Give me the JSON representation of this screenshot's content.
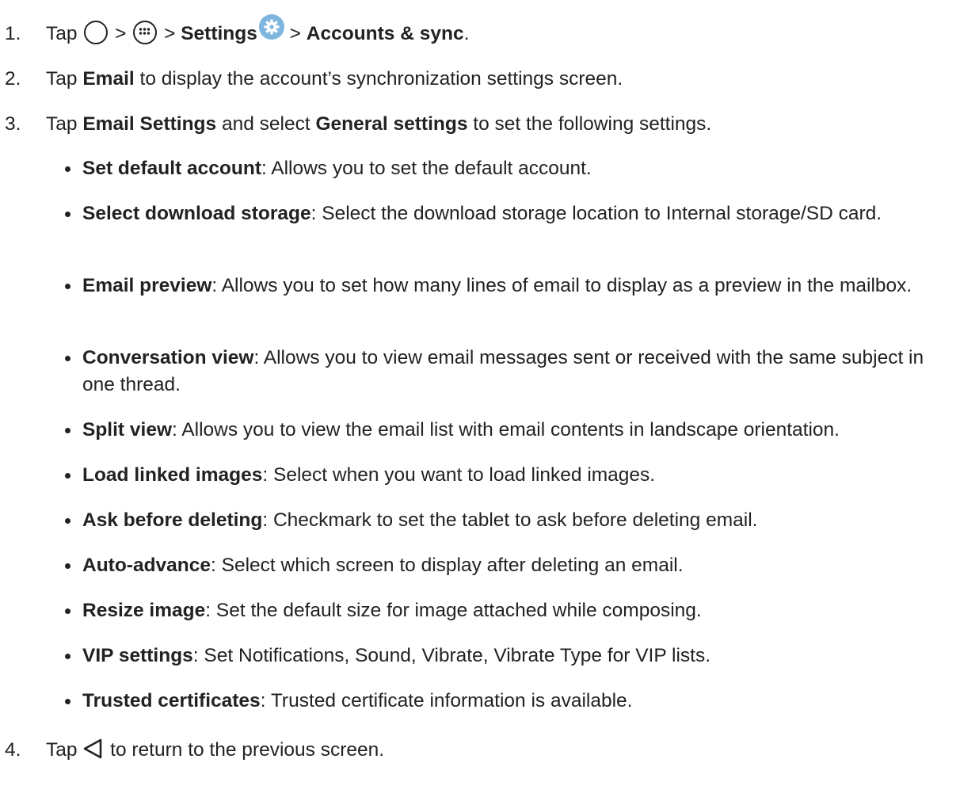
{
  "steps": [
    {
      "number": "1.",
      "tap": "Tap",
      "sep1": ">",
      "sep2": ">",
      "settings": "Settings",
      "sep3": ">",
      "accounts": "Accounts & sync",
      "end": ".",
      "icons": [
        "home-icon",
        "apps-icon",
        "settings-icon"
      ]
    },
    {
      "number": "2.",
      "tap": "Tap",
      "email": "Email",
      "rest": "to display the account’s synchronization settings screen."
    },
    {
      "number": "3.",
      "tap": "Tap",
      "email_settings": "Email Settings",
      "and_select": "and select",
      "general_settings": "General settings",
      "rest": "to set the following settings."
    },
    {
      "number": "4.",
      "tap": "Tap",
      "rest": "to return to the previous screen.",
      "icons": [
        "back-icon"
      ]
    }
  ],
  "settings_list": [
    {
      "name": "Set default account",
      "desc": "Allows you to set the default account."
    },
    {
      "name": "Select download storage",
      "desc": "Select the download storage location to Internal storage/SD card."
    },
    {
      "name": "Email preview",
      "desc": "Allows you to set how many lines of email to display as a preview in the mailbox."
    },
    {
      "name": "Conversation view",
      "desc": "Allows you to view email messages sent or received with the same subject in one thread."
    },
    {
      "name": "Split view",
      "desc": "Allows you to view the email list with email contents in landscape orientation."
    },
    {
      "name": "Load linked images",
      "desc": "Select when you want to load linked images."
    },
    {
      "name": "Ask before deleting",
      "desc": "Checkmark to set the tablet to ask before deleting email."
    },
    {
      "name": "Auto-advance",
      "desc": "Select which screen to display after deleting an email."
    },
    {
      "name": "Resize image",
      "desc": "Set the default size for image attached while composing."
    },
    {
      "name": "VIP settings",
      "desc": "Set Notifications, Sound, Vibrate, Vibrate Type for VIP lists."
    },
    {
      "name": "Trusted certificates",
      "desc": "Trusted certificate information is available."
    }
  ],
  "colors": {
    "text": "#222222",
    "settings_icon_bg": "#7eb6df"
  }
}
